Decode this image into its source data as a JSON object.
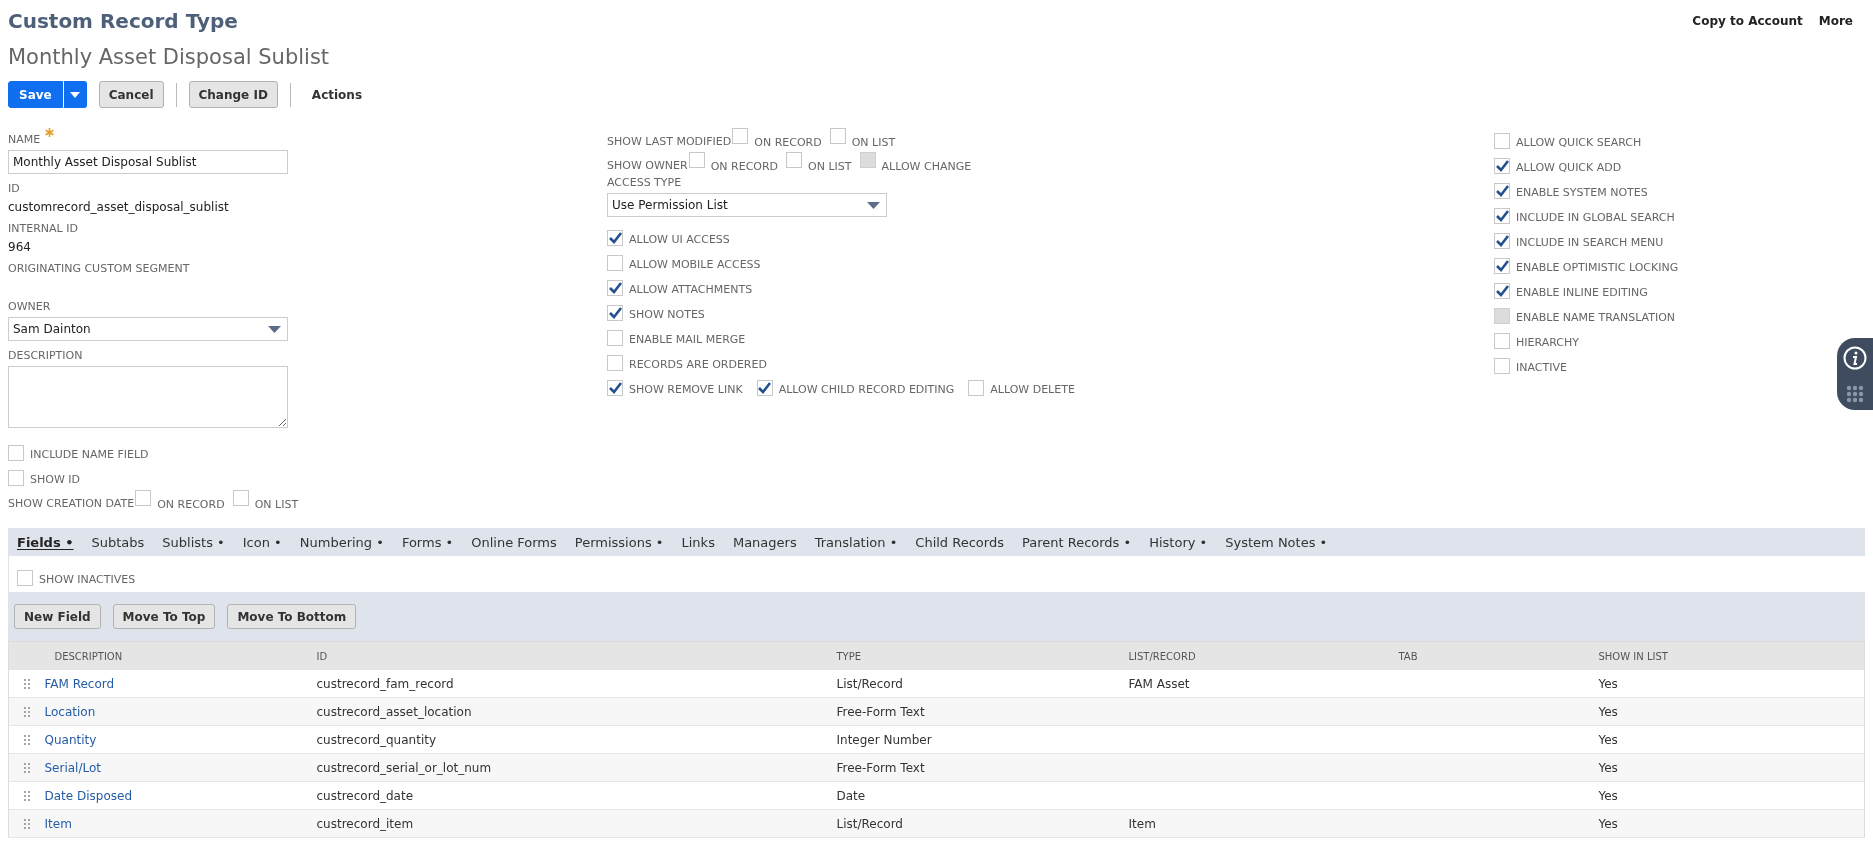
{
  "header": {
    "title": "Custom Record Type",
    "subtitle": "Monthly Asset Disposal Sublist",
    "top_links": [
      "Copy to Account",
      "More"
    ]
  },
  "toolbar": [
    {
      "label": "Save",
      "kind": "primary",
      "separator_before": false
    },
    {
      "label": "Cancel",
      "kind": "secondary",
      "separator_before": false
    },
    {
      "label": "Change ID",
      "kind": "secondary",
      "separator_before": true
    },
    {
      "label": "Actions",
      "kind": "menu",
      "separator_before": true
    }
  ],
  "form": {
    "left": [
      {
        "kind": "text_field",
        "label": "NAME",
        "required": true,
        "value": "Monthly Asset Disposal Sublist"
      },
      {
        "kind": "info",
        "label": "ID",
        "value": "customrecord_asset_disposal_sublist"
      },
      {
        "kind": "info",
        "label": "INTERNAL ID",
        "value": "964"
      },
      {
        "kind": "label",
        "label": "ORIGINATING CUSTOM SEGMENT"
      },
      {
        "kind": "select",
        "label": "OWNER",
        "value": "Sam Dainton"
      },
      {
        "kind": "textarea",
        "label": "DESCRIPTION"
      },
      {
        "kind": "checkbox",
        "label": "INCLUDE NAME FIELD",
        "checked": false,
        "disabled": false
      },
      {
        "kind": "checkbox",
        "label": "SHOW ID",
        "checked": false,
        "disabled": false
      },
      {
        "kind": "group",
        "label": "SHOW CREATION DATE",
        "options": [
          {
            "label": "ON RECORD",
            "checked": false,
            "disabled": false
          },
          {
            "label": "ON LIST",
            "checked": false,
            "disabled": false
          }
        ]
      }
    ],
    "middle": [
      {
        "kind": "group",
        "label": "SHOW LAST MODIFIED",
        "options": [
          {
            "label": "ON RECORD",
            "checked": false,
            "disabled": false
          },
          {
            "label": "ON LIST",
            "checked": false,
            "disabled": false
          }
        ]
      },
      {
        "kind": "group",
        "label": "SHOW OWNER",
        "options": [
          {
            "label": "ON RECORD",
            "checked": false,
            "disabled": false
          },
          {
            "label": "ON LIST",
            "checked": false,
            "disabled": false
          },
          {
            "label": "ALLOW CHANGE",
            "checked": false,
            "disabled": true
          }
        ]
      },
      {
        "kind": "select",
        "label": "ACCESS TYPE",
        "value": "Use Permission List"
      },
      {
        "kind": "checkbox",
        "label": "ALLOW UI ACCESS",
        "checked": true,
        "disabled": false
      },
      {
        "kind": "checkbox",
        "label": "ALLOW MOBILE ACCESS",
        "checked": false,
        "disabled": false
      },
      {
        "kind": "checkbox",
        "label": "ALLOW ATTACHMENTS",
        "checked": true,
        "disabled": false
      },
      {
        "kind": "checkbox",
        "label": "SHOW NOTES",
        "checked": true,
        "disabled": false
      },
      {
        "kind": "checkbox",
        "label": "ENABLE MAIL MERGE",
        "checked": false,
        "disabled": false
      },
      {
        "kind": "checkbox",
        "label": "RECORDS ARE ORDERED",
        "checked": false,
        "disabled": false
      },
      {
        "kind": "row",
        "options": [
          {
            "label": "SHOW REMOVE LINK",
            "checked": true,
            "disabled": false
          },
          {
            "label": "ALLOW CHILD RECORD EDITING",
            "checked": true,
            "disabled": false
          },
          {
            "label": "ALLOW DELETE",
            "checked": false,
            "disabled": false
          }
        ]
      }
    ],
    "right": [
      {
        "kind": "checkbox",
        "label": "ALLOW QUICK SEARCH",
        "checked": false,
        "disabled": false
      },
      {
        "kind": "checkbox",
        "label": "ALLOW QUICK ADD",
        "checked": true,
        "disabled": false
      },
      {
        "kind": "checkbox",
        "label": "ENABLE SYSTEM NOTES",
        "checked": true,
        "disabled": false
      },
      {
        "kind": "checkbox",
        "label": "INCLUDE IN GLOBAL SEARCH",
        "checked": true,
        "disabled": false
      },
      {
        "kind": "checkbox",
        "label": "INCLUDE IN SEARCH MENU",
        "checked": true,
        "disabled": false
      },
      {
        "kind": "checkbox",
        "label": "ENABLE OPTIMISTIC LOCKING",
        "checked": true,
        "disabled": false
      },
      {
        "kind": "checkbox",
        "label": "ENABLE INLINE EDITING",
        "checked": true,
        "disabled": false
      },
      {
        "kind": "checkbox",
        "label": "ENABLE NAME TRANSLATION",
        "checked": false,
        "disabled": true
      },
      {
        "kind": "checkbox",
        "label": "HIERARCHY",
        "checked": false,
        "disabled": false
      },
      {
        "kind": "checkbox",
        "label": "INACTIVE",
        "checked": false,
        "disabled": false
      }
    ]
  },
  "subtabs": [
    {
      "label": "Fields •",
      "selected": true
    },
    {
      "label": "Subtabs",
      "selected": false
    },
    {
      "label": "Sublists •",
      "selected": false
    },
    {
      "label": "Icon •",
      "selected": false
    },
    {
      "label": "Numbering •",
      "selected": false
    },
    {
      "label": "Forms •",
      "selected": false
    },
    {
      "label": "Online Forms",
      "selected": false
    },
    {
      "label": "Permissions •",
      "selected": false
    },
    {
      "label": "Links",
      "selected": false
    },
    {
      "label": "Managers",
      "selected": false
    },
    {
      "label": "Translation •",
      "selected": false
    },
    {
      "label": "Child Records",
      "selected": false
    },
    {
      "label": "Parent Records •",
      "selected": false
    },
    {
      "label": "History •",
      "selected": false
    },
    {
      "label": "System Notes •",
      "selected": false
    }
  ],
  "fields_panel": {
    "show_inactives": {
      "label": "SHOW INACTIVES",
      "checked": false
    },
    "buttons": [
      "New Field",
      "Move To Top",
      "Move To Bottom"
    ],
    "table": {
      "columns": [
        "DESCRIPTION",
        "ID",
        "TYPE",
        "LIST/RECORD",
        "TAB",
        "SHOW IN LIST"
      ],
      "rows": [
        [
          "FAM Record",
          "custrecord_fam_record",
          "List/Record",
          "FAM Asset",
          "",
          "Yes"
        ],
        [
          "Location",
          "custrecord_asset_location",
          "Free-Form Text",
          "",
          "",
          "Yes"
        ],
        [
          "Quantity",
          "custrecord_quantity",
          "Integer Number",
          "",
          "",
          "Yes"
        ],
        [
          "Serial/Lot",
          "custrecord_serial_or_lot_num",
          "Free-Form Text",
          "",
          "",
          "Yes"
        ],
        [
          "Date Disposed",
          "custrecord_date",
          "Date",
          "",
          "",
          "Yes"
        ],
        [
          "Item",
          "custrecord_item",
          "List/Record",
          "Item",
          "",
          "Yes"
        ]
      ]
    }
  }
}
